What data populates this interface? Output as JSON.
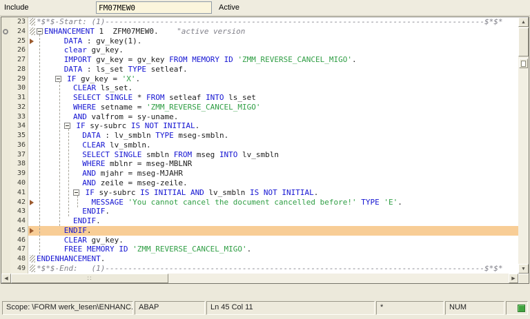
{
  "colors": {
    "keyword": "#1414d2",
    "string": "#2f9e44",
    "comment": "#7f7f88",
    "highlight": "#f8cd96"
  },
  "header": {
    "include_label": "Include",
    "include_value": "FM07MEW0",
    "active_label": "Active"
  },
  "editor": {
    "lines": [
      {
        "n": "23",
        "m": "hatch",
        "tokens": [
          {
            "c": "cmt",
            "t": "*$*$-Start: (1)-----------------------------------------------------------------------------------$*$*"
          }
        ]
      },
      {
        "n": "24",
        "m": "hatch",
        "icon": true,
        "tokens": [
          {
            "c": "fold"
          },
          {
            "c": "kw",
            "t": "ENHANCEMENT"
          },
          {
            "c": "pln",
            "t": " 1  ZFM07MEW0.    "
          },
          {
            "c": "cmt",
            "t": "\"active version"
          }
        ]
      },
      {
        "n": "25",
        "m": "arrow",
        "tokens": [
          {
            "c": "pln",
            "t": "      "
          },
          {
            "c": "kw",
            "t": "DATA"
          },
          {
            "c": "pln",
            "t": " : gv_key(1)."
          }
        ]
      },
      {
        "n": "26",
        "tokens": [
          {
            "c": "pln",
            "t": "      "
          },
          {
            "c": "kw",
            "t": "clear"
          },
          {
            "c": "pln",
            "t": " gv_key."
          }
        ]
      },
      {
        "n": "27",
        "tokens": [
          {
            "c": "pln",
            "t": "      "
          },
          {
            "c": "kw",
            "t": "IMPORT"
          },
          {
            "c": "pln",
            "t": " gv_key = gv_key "
          },
          {
            "c": "kw",
            "t": "FROM MEMORY ID"
          },
          {
            "c": "pln",
            "t": " "
          },
          {
            "c": "str",
            "t": "'ZMM_REVERSE_CANCEL_MIGO'"
          },
          {
            "c": "pln",
            "t": "."
          }
        ]
      },
      {
        "n": "28",
        "tokens": [
          {
            "c": "pln",
            "t": "      "
          },
          {
            "c": "kw",
            "t": "DATA"
          },
          {
            "c": "pln",
            "t": " : ls_set "
          },
          {
            "c": "kw",
            "t": "TYPE"
          },
          {
            "c": "pln",
            "t": " setleaf."
          }
        ]
      },
      {
        "n": "29",
        "tokens": [
          {
            "c": "pln",
            "t": "    "
          },
          {
            "c": "fold"
          },
          {
            "c": "pln",
            "t": " "
          },
          {
            "c": "kw",
            "t": "IF"
          },
          {
            "c": "pln",
            "t": " gv_key = "
          },
          {
            "c": "str",
            "t": "'X'"
          },
          {
            "c": "pln",
            "t": "."
          }
        ]
      },
      {
        "n": "30",
        "tokens": [
          {
            "c": "pln",
            "t": "        "
          },
          {
            "c": "kw",
            "t": "CLEAR"
          },
          {
            "c": "pln",
            "t": " ls_set."
          }
        ]
      },
      {
        "n": "31",
        "tokens": [
          {
            "c": "pln",
            "t": "        "
          },
          {
            "c": "kw",
            "t": "SELECT SINGLE"
          },
          {
            "c": "pln",
            "t": " * "
          },
          {
            "c": "kw",
            "t": "FROM"
          },
          {
            "c": "pln",
            "t": " setleaf "
          },
          {
            "c": "kw",
            "t": "INTO"
          },
          {
            "c": "pln",
            "t": " ls_set"
          }
        ]
      },
      {
        "n": "32",
        "tokens": [
          {
            "c": "pln",
            "t": "        "
          },
          {
            "c": "kw",
            "t": "WHERE"
          },
          {
            "c": "pln",
            "t": " setname = "
          },
          {
            "c": "str",
            "t": "'ZMM_REVERSE_CANCEL_MIGO'"
          }
        ]
      },
      {
        "n": "33",
        "tokens": [
          {
            "c": "pln",
            "t": "        "
          },
          {
            "c": "kw",
            "t": "AND"
          },
          {
            "c": "pln",
            "t": " valfrom = sy-uname."
          }
        ]
      },
      {
        "n": "34",
        "tokens": [
          {
            "c": "pln",
            "t": "      "
          },
          {
            "c": "fold"
          },
          {
            "c": "pln",
            "t": " "
          },
          {
            "c": "kw",
            "t": "IF"
          },
          {
            "c": "pln",
            "t": " sy-subrc "
          },
          {
            "c": "kw",
            "t": "IS NOT INITIAL"
          },
          {
            "c": "pln",
            "t": "."
          }
        ]
      },
      {
        "n": "35",
        "tokens": [
          {
            "c": "pln",
            "t": "          "
          },
          {
            "c": "kw",
            "t": "DATA"
          },
          {
            "c": "pln",
            "t": " : lv_smbln "
          },
          {
            "c": "kw",
            "t": "TYPE"
          },
          {
            "c": "pln",
            "t": " mseg-smbln."
          }
        ]
      },
      {
        "n": "36",
        "tokens": [
          {
            "c": "pln",
            "t": "          "
          },
          {
            "c": "kw",
            "t": "CLEAR"
          },
          {
            "c": "pln",
            "t": " lv_smbln."
          }
        ]
      },
      {
        "n": "37",
        "tokens": [
          {
            "c": "pln",
            "t": "          "
          },
          {
            "c": "kw",
            "t": "SELECT SINGLE"
          },
          {
            "c": "pln",
            "t": " smbln "
          },
          {
            "c": "kw",
            "t": "FROM"
          },
          {
            "c": "pln",
            "t": " mseg "
          },
          {
            "c": "kw",
            "t": "INTO"
          },
          {
            "c": "pln",
            "t": " lv_smbln"
          }
        ]
      },
      {
        "n": "38",
        "tokens": [
          {
            "c": "pln",
            "t": "          "
          },
          {
            "c": "kw",
            "t": "WHERE"
          },
          {
            "c": "pln",
            "t": " mblnr = mseg-MBLNR"
          }
        ]
      },
      {
        "n": "39",
        "tokens": [
          {
            "c": "pln",
            "t": "          "
          },
          {
            "c": "kw",
            "t": "AND"
          },
          {
            "c": "pln",
            "t": " mjahr = mseg-MJAHR"
          }
        ]
      },
      {
        "n": "40",
        "tokens": [
          {
            "c": "pln",
            "t": "          "
          },
          {
            "c": "kw",
            "t": "AND"
          },
          {
            "c": "pln",
            "t": " zeile = mseg-zeile."
          }
        ]
      },
      {
        "n": "41",
        "tokens": [
          {
            "c": "pln",
            "t": "        "
          },
          {
            "c": "fold"
          },
          {
            "c": "pln",
            "t": " "
          },
          {
            "c": "kw",
            "t": "IF"
          },
          {
            "c": "pln",
            "t": " sy-subrc "
          },
          {
            "c": "kw",
            "t": "IS INITIAL AND"
          },
          {
            "c": "pln",
            "t": " lv_smbln "
          },
          {
            "c": "kw",
            "t": "IS NOT INITIAL"
          },
          {
            "c": "pln",
            "t": "."
          }
        ]
      },
      {
        "n": "42",
        "m": "arrow",
        "tokens": [
          {
            "c": "pln",
            "t": "            "
          },
          {
            "c": "kw",
            "t": "MESSAGE"
          },
          {
            "c": "pln",
            "t": " "
          },
          {
            "c": "str",
            "t": "'You cannot cancel the document cancelled before!'"
          },
          {
            "c": "pln",
            "t": " "
          },
          {
            "c": "kw",
            "t": "TYPE"
          },
          {
            "c": "pln",
            "t": " "
          },
          {
            "c": "str",
            "t": "'E'"
          },
          {
            "c": "pln",
            "t": "."
          }
        ]
      },
      {
        "n": "43",
        "tokens": [
          {
            "c": "pln",
            "t": "          "
          },
          {
            "c": "kw",
            "t": "ENDIF"
          },
          {
            "c": "pln",
            "t": "."
          }
        ]
      },
      {
        "n": "44",
        "tokens": [
          {
            "c": "pln",
            "t": "        "
          },
          {
            "c": "kw",
            "t": "ENDIF"
          },
          {
            "c": "pln",
            "t": "."
          }
        ]
      },
      {
        "n": "45",
        "m": "arrow",
        "highlight": true,
        "tokens": [
          {
            "c": "pln",
            "t": "      "
          },
          {
            "c": "kw",
            "t": "ENDIF"
          },
          {
            "c": "pln",
            "t": "."
          }
        ]
      },
      {
        "n": "46",
        "tokens": [
          {
            "c": "pln",
            "t": "      "
          },
          {
            "c": "kw",
            "t": "CLEAR"
          },
          {
            "c": "pln",
            "t": " gv_key."
          }
        ]
      },
      {
        "n": "47",
        "tokens": [
          {
            "c": "pln",
            "t": "      "
          },
          {
            "c": "kw",
            "t": "FREE MEMORY ID"
          },
          {
            "c": "pln",
            "t": " "
          },
          {
            "c": "str",
            "t": "'ZMM_REVERSE_CANCEL_MIGO'"
          },
          {
            "c": "pln",
            "t": "."
          }
        ]
      },
      {
        "n": "48",
        "m": "hatch",
        "tokens": [
          {
            "c": "kw",
            "t": "ENDENHANCEMENT"
          },
          {
            "c": "pln",
            "t": "."
          }
        ]
      },
      {
        "n": "49",
        "m": "hatch",
        "tokens": [
          {
            "c": "cmt",
            "t": "*$*$-End:   (1)-----------------------------------------------------------------------------------$*$*"
          }
        ]
      }
    ],
    "guides": [
      {
        "start": 25,
        "end": 47,
        "ch": 0.5
      },
      {
        "start": 30,
        "end": 44,
        "ch": 4.8
      },
      {
        "start": 35,
        "end": 43,
        "ch": 6.8
      },
      {
        "start": 42,
        "end": 42,
        "ch": 8.8
      }
    ]
  },
  "statusbar": {
    "scope": "Scope: \\FORM werk_lesen\\ENHANC...",
    "lang": "ABAP",
    "position": "Ln 45 Col 11",
    "modified": "*",
    "numlock": "NUM"
  }
}
